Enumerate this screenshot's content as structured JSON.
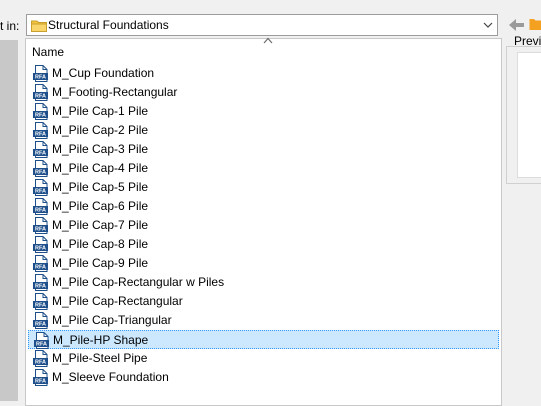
{
  "dialog": {
    "look_in_label": "Look in:",
    "look_in_label_visible": "t in:",
    "current_folder": "Structural Foundations",
    "preview_label": "Previe"
  },
  "list": {
    "column_name": "Name",
    "file_badge": "RFA",
    "items": [
      {
        "name": "M_Cup Foundation",
        "selected": false
      },
      {
        "name": "M_Footing-Rectangular",
        "selected": false
      },
      {
        "name": "M_Pile Cap-1 Pile",
        "selected": false
      },
      {
        "name": "M_Pile Cap-2 Pile",
        "selected": false
      },
      {
        "name": "M_Pile Cap-3 Pile",
        "selected": false
      },
      {
        "name": "M_Pile Cap-4 Pile",
        "selected": false
      },
      {
        "name": "M_Pile Cap-5 Pile",
        "selected": false
      },
      {
        "name": "M_Pile Cap-6 Pile",
        "selected": false
      },
      {
        "name": "M_Pile Cap-7 Pile",
        "selected": false
      },
      {
        "name": "M_Pile Cap-8 Pile",
        "selected": false
      },
      {
        "name": "M_Pile Cap-9 Pile",
        "selected": false
      },
      {
        "name": "M_Pile Cap-Rectangular w Piles",
        "selected": false
      },
      {
        "name": "M_Pile Cap-Rectangular",
        "selected": false
      },
      {
        "name": "M_Pile Cap-Triangular",
        "selected": false
      },
      {
        "name": "M_Pile-HP Shape",
        "selected": true
      },
      {
        "name": "M_Pile-Steel Pipe",
        "selected": false
      },
      {
        "name": "M_Sleeve Foundation",
        "selected": false
      }
    ]
  },
  "colors": {
    "selection_bg": "#cce8ff",
    "selection_border": "#3399ff",
    "rfa_icon_blue": "#1e4f8a",
    "folder_yellow": "#f4c542",
    "back_arrow": "#9a9a9a"
  }
}
